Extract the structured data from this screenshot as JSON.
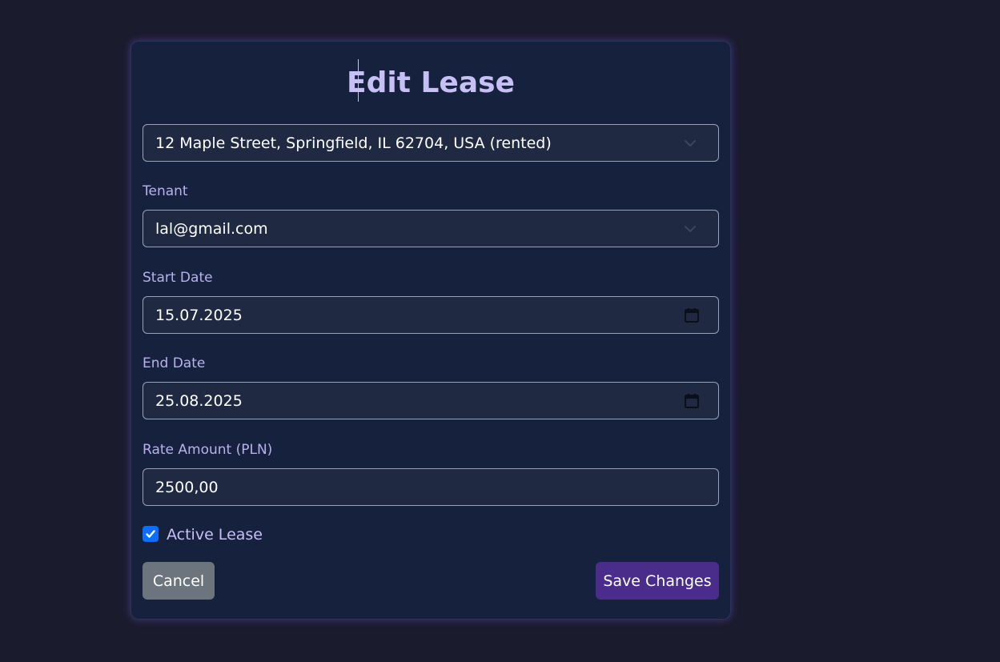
{
  "page": {
    "title": "Edit Lease"
  },
  "form": {
    "property": {
      "value": "12 Maple Street, Springfield, IL 62704, USA (rented)"
    },
    "tenant": {
      "label": "Tenant",
      "value": "lal@gmail.com"
    },
    "start_date": {
      "label": "Start Date",
      "value": "15.07.2025"
    },
    "end_date": {
      "label": "End Date",
      "value": "25.08.2025"
    },
    "rate_amount": {
      "label": "Rate Amount (PLN)",
      "value": "2500,00"
    },
    "active_lease": {
      "label": "Active Lease",
      "checked": true
    }
  },
  "actions": {
    "cancel_label": "Cancel",
    "save_label": "Save Changes"
  },
  "icons": {
    "select_chevron": "chevron-down-icon",
    "date_picker": "calendar-icon",
    "checkbox_check": "check-icon"
  },
  "colors": {
    "background": "#1b1b2e",
    "card": "#16213e",
    "title": "#c7c0f5",
    "label": "#b8b2ec",
    "input_bg": "#1f2a42",
    "checkbox": "#0d6efd",
    "cancel_button": "#6c757d",
    "save_button": "#4a2d8a"
  }
}
